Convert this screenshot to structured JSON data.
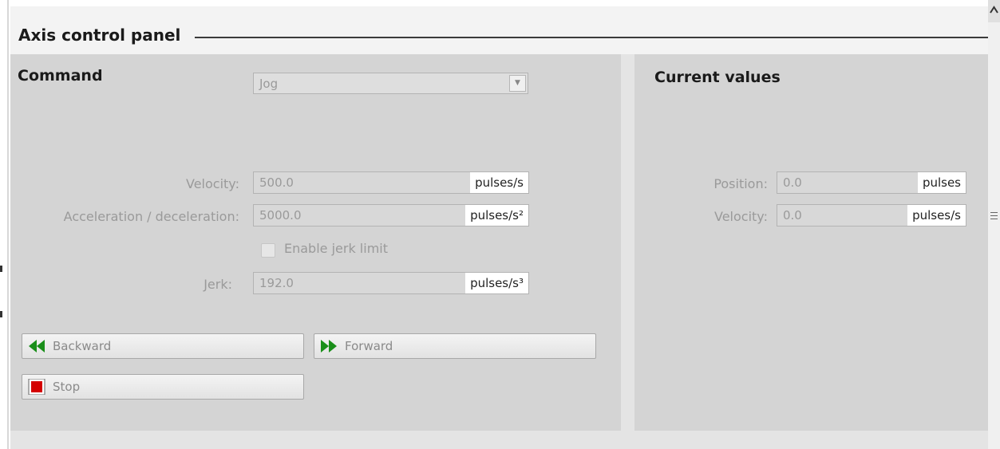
{
  "panel": {
    "title": "Axis control panel"
  },
  "command": {
    "title": "Command",
    "mode": {
      "selected": "Jog"
    },
    "velocity": {
      "label": "Velocity:",
      "value": "500.0",
      "unit": "pulses/s"
    },
    "acceleration": {
      "label": "Acceleration / deceleration:",
      "value": "5000.0",
      "unit": "pulses/s²"
    },
    "jerk_limit": {
      "label": "Enable jerk limit",
      "checked": false
    },
    "jerk": {
      "label": "Jerk:",
      "value": "192.0",
      "unit": "pulses/s³"
    },
    "buttons": {
      "backward": "Backward",
      "forward": "Forward",
      "stop": "Stop"
    }
  },
  "current": {
    "title": "Current values",
    "position": {
      "label": "Position:",
      "value": "0.0",
      "unit": "pulses"
    },
    "velocity": {
      "label": "Velocity:",
      "value": "0.0",
      "unit": "pulses/s"
    }
  },
  "icons": {
    "backward": "double-arrow-left-icon",
    "forward": "double-arrow-right-icon",
    "stop": "stop-square-icon",
    "dropdown": "chevron-down-icon"
  },
  "colors": {
    "arrow_green": "#1a8f1a",
    "stop_red": "#d40000",
    "panel_gray": "#d4d4d4"
  }
}
